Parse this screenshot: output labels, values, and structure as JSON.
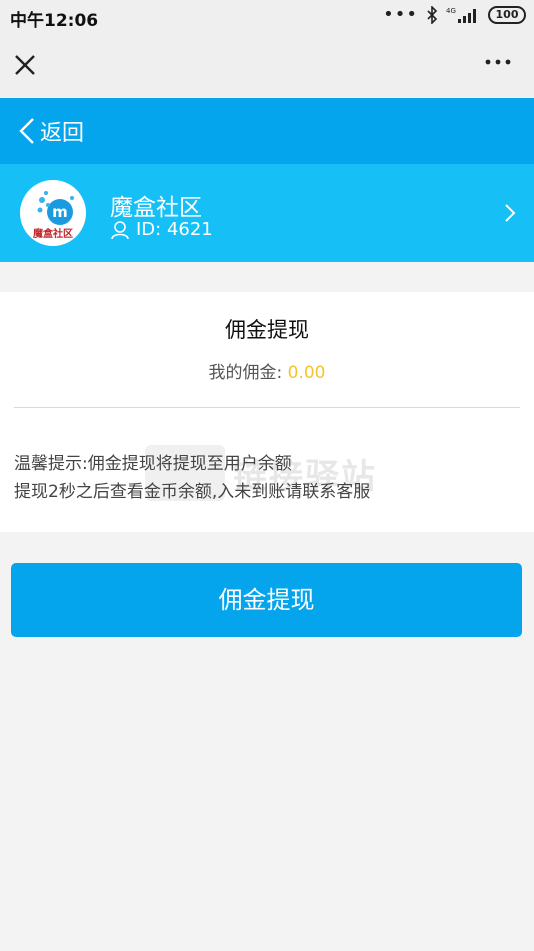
{
  "status_bar": {
    "time": "中午12:06",
    "dots": "•••",
    "network": "4G",
    "battery": "100"
  },
  "top_bar": {
    "close_icon": "close-icon",
    "more_icon": "more-dots-icon"
  },
  "header": {
    "back_label": "返回"
  },
  "profile": {
    "avatar_label": "魔盒社区",
    "name": "魔盒社区",
    "id_text": "ID: 4621"
  },
  "withdraw": {
    "title": "佣金提现",
    "commission_label": "我的佣金: ",
    "commission_value": "0.00",
    "tip_line1": "温馨提示:佣金提现将提现至用户余额",
    "tip_line2": "提现2秒之后查看金币余额,入未到账请联系客服",
    "button_label": "佣金提现"
  },
  "watermark": {
    "text": "链接驿站"
  },
  "colors": {
    "header_blue": "#05a5ee",
    "profile_blue": "#16c0f6",
    "amount_yellow": "#f4c430"
  }
}
